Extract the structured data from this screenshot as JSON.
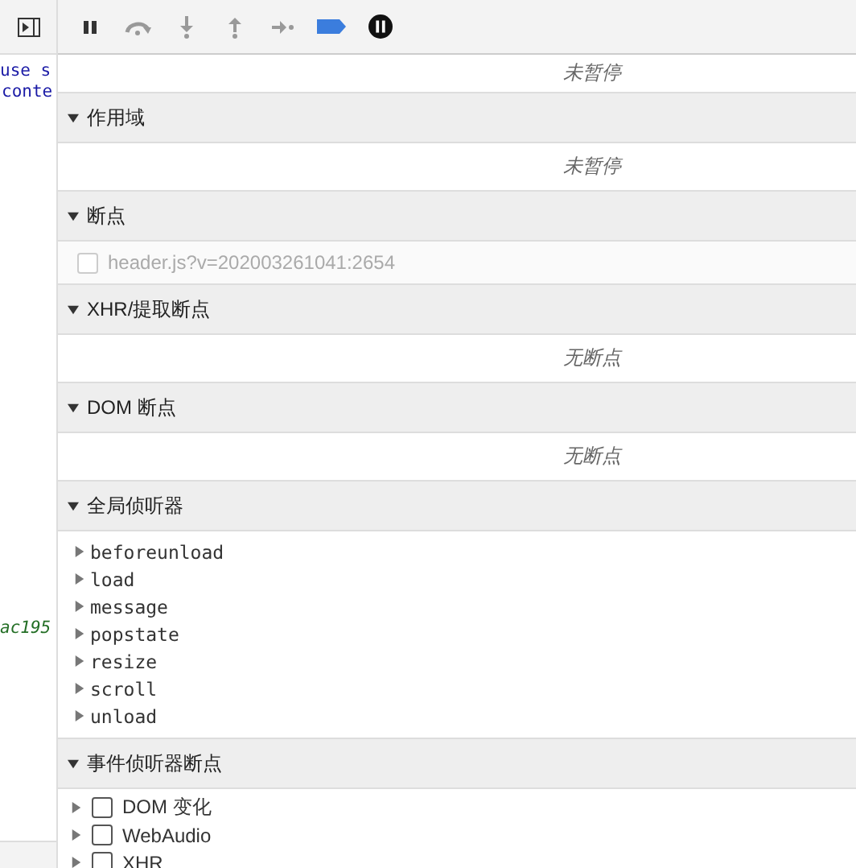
{
  "code_strip": {
    "lines": [
      {
        "text": "use s",
        "kind": "string"
      },
      {
        "text": "conte",
        "kind": "plain"
      },
      {
        "text": "ac195",
        "kind": "hash"
      }
    ]
  },
  "toolbar": [
    {
      "kind": "pause",
      "disabled": false
    },
    {
      "kind": "step-over",
      "disabled": true
    },
    {
      "kind": "step-into",
      "disabled": true
    },
    {
      "kind": "step-out",
      "disabled": true
    },
    {
      "kind": "step",
      "disabled": true
    },
    {
      "kind": "deactivate",
      "disabled": false
    },
    {
      "kind": "pause-exceptions",
      "disabled": false
    }
  ],
  "sections": [
    {
      "kind": "status",
      "message": "未暂停"
    },
    {
      "kind": "message",
      "title": "作用域",
      "expanded": true,
      "message": "未暂停"
    },
    {
      "kind": "checklist",
      "title": "断点",
      "expanded": true,
      "items": [
        {
          "label": "header.js?v=202003261041:2654",
          "checked": false,
          "disabled": true
        }
      ]
    },
    {
      "kind": "message",
      "title": "XHR/提取断点",
      "expanded": true,
      "message": "无断点"
    },
    {
      "kind": "message",
      "title": "DOM 断点",
      "expanded": true,
      "message": "无断点"
    },
    {
      "kind": "tree",
      "title": "全局侦听器",
      "expanded": true,
      "items": [
        {
          "label": "beforeunload",
          "expanded": false
        },
        {
          "label": "load",
          "expanded": false
        },
        {
          "label": "message",
          "expanded": false
        },
        {
          "label": "popstate",
          "expanded": false
        },
        {
          "label": "resize",
          "expanded": false
        },
        {
          "label": "scroll",
          "expanded": false
        },
        {
          "label": "unload",
          "expanded": false
        }
      ]
    },
    {
      "kind": "categories",
      "title": "事件侦听器断点",
      "expanded": true,
      "items": [
        {
          "label": "DOM 变化",
          "checked": false,
          "expanded": false
        },
        {
          "label": "WebAudio",
          "checked": false,
          "expanded": false
        },
        {
          "label": "XHR",
          "checked": false,
          "expanded": false
        }
      ]
    }
  ]
}
